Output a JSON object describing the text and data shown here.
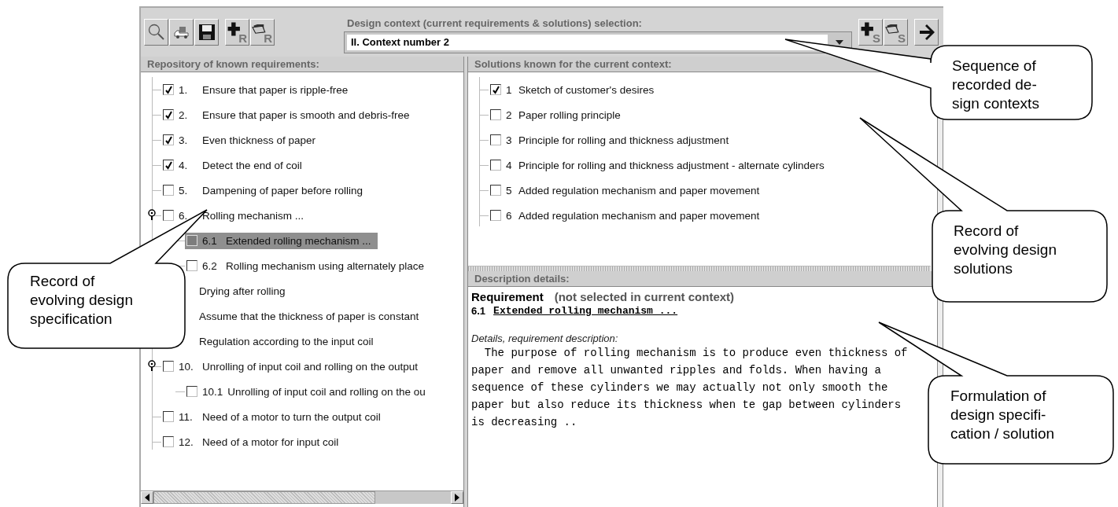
{
  "toolbar": {
    "left_groups": [
      [
        {
          "kind": "search"
        },
        {
          "kind": "truck"
        },
        {
          "kind": "save"
        }
      ],
      [
        {
          "kind": "add",
          "badge": "R"
        },
        {
          "kind": "open",
          "badge": "R"
        }
      ]
    ],
    "context_selector": {
      "label": "Design context (current requirements & solutions) selection:",
      "value": "II. Context number 2"
    },
    "right_groups": [
      [
        {
          "kind": "add",
          "badge": "S"
        },
        {
          "kind": "open",
          "badge": "S"
        }
      ],
      [
        {
          "kind": "forward"
        }
      ]
    ]
  },
  "requirements": {
    "title": "Repository of known requirements:",
    "items": [
      {
        "number": "1.",
        "text": "Ensure that paper is ripple-free",
        "checked": true,
        "selected": false
      },
      {
        "number": "2.",
        "text": "Ensure that paper is smooth and debris-free",
        "checked": true,
        "selected": false
      },
      {
        "number": "3.",
        "text": "Even thickness of paper",
        "checked": true,
        "selected": false
      },
      {
        "number": "4.",
        "text": "Detect the end of coil",
        "checked": true,
        "selected": false
      },
      {
        "number": "5.",
        "text": "Dampening of paper before rolling",
        "checked": false,
        "selected": false
      },
      {
        "number": "6.",
        "text": "Rolling mechanism ...",
        "checked": false,
        "selected": false,
        "expanded": true,
        "children": [
          {
            "number": "6.1",
            "text": "Extended rolling mechanism ...",
            "checked": false,
            "selected": true
          },
          {
            "number": "6.2",
            "text": "Rolling mechanism using alternately place",
            "checked": false,
            "selected": false
          }
        ]
      },
      {
        "text": "Drying after rolling",
        "selected": false
      },
      {
        "text": "Assume that the thickness of paper is constant",
        "selected": false
      },
      {
        "text": "Regulation according to the input coil",
        "selected": false
      },
      {
        "number": "10.",
        "text": "Unrolling of input coil and rolling on the output",
        "checked": false,
        "selected": false,
        "expanded": true,
        "children": [
          {
            "number": "10.1",
            "text": "Unrolling of input coil and rolling on the ou",
            "checked": false,
            "selected": false
          }
        ]
      },
      {
        "number": "11.",
        "text": "Need of a motor to turn the output coil",
        "checked": false,
        "selected": false
      },
      {
        "number": "12.",
        "text": "Need of a motor for input coil",
        "checked": false,
        "selected": false
      }
    ]
  },
  "solutions": {
    "title": "Solutions known for the current context:",
    "items": [
      {
        "number": "1",
        "text": "Sketch of customer's desires",
        "checked": true
      },
      {
        "number": "2",
        "text": "Paper rolling principle",
        "checked": false
      },
      {
        "number": "3",
        "text": "Principle for rolling and thickness adjustment",
        "checked": false
      },
      {
        "number": "4",
        "text": "Principle for rolling and thickness adjustment - alternate cylinders",
        "checked": false
      },
      {
        "number": "5",
        "text": "Added regulation mechanism and paper movement",
        "checked": false
      },
      {
        "number": "6",
        "text": "Added regulation mechanism and paper movement",
        "checked": false
      }
    ]
  },
  "description": {
    "title": "Description details:",
    "heading": "Requirement",
    "status": "(not selected in current context)",
    "item_number": "6.1",
    "item_title": "Extended rolling mechanism ...",
    "details_label": "Details, requirement description:",
    "lines": [
      "  The purpose of rolling mechanism is to produce even thickness of",
      "paper and remove all unwanted ripples and folds. When having a",
      "sequence of these cylinders we may actually not only smooth the",
      "paper but also reduce its thickness when te gap between cylinders",
      "is decreasing .."
    ]
  },
  "annotations": [
    {
      "text": "Sequence of\nrecorded de-\nsign contexts"
    },
    {
      "text": "Record of\nevolving design\nsolutions"
    },
    {
      "text": "Formulation of\ndesign specifi-\ncation / solution"
    },
    {
      "text": "Record of\nevolving design\nspecification"
    }
  ]
}
